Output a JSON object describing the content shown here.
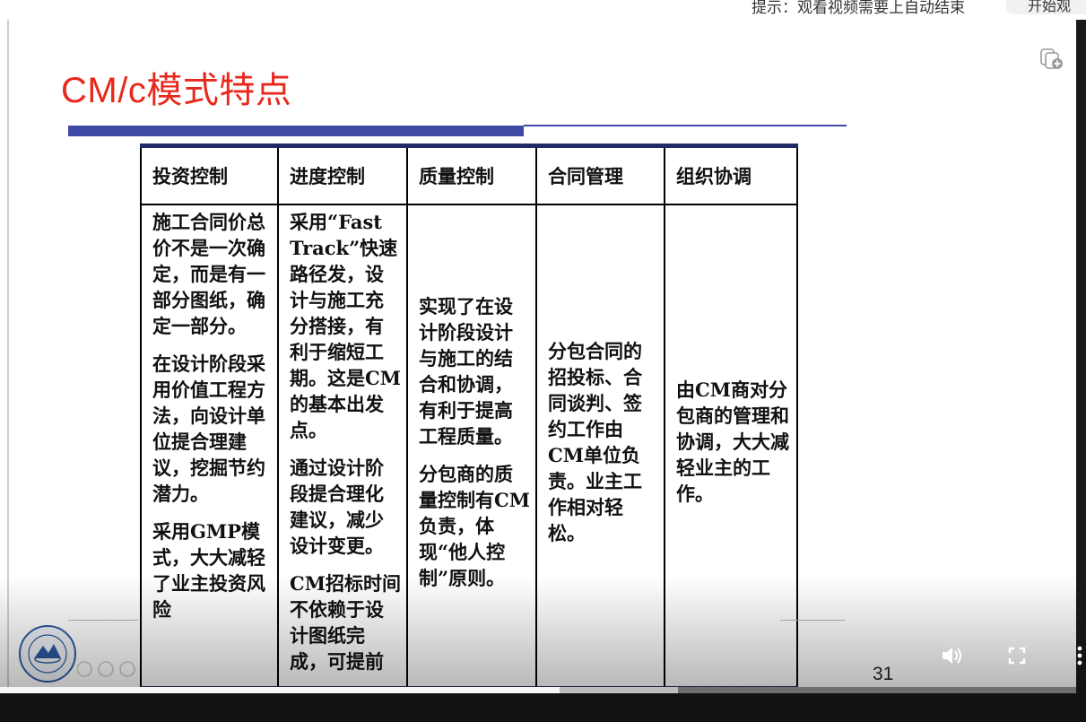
{
  "browser_bar": {
    "hint_text": "提示：观看视频需要上自动结束",
    "pill_text": "开始观"
  },
  "slide": {
    "title": "CM/c模式特点",
    "page_number": "31",
    "table": {
      "headers": [
        "投资控制",
        "进度控制",
        "质量控制",
        "合同管理",
        "组织协调"
      ],
      "columns": [
        [
          "施工合同价总价不是一次确定，而是有一部分图纸，确定一部分。",
          "在设计阶段采用价值工程方法，向设计单位提合理建议，挖掘节约潜力。",
          "采用GMP模式，大大减轻了业主投资风险"
        ],
        [
          "采用“Fast Track”快速路径发，设计与施工充分搭接，有利于缩短工期。这是CM的基本出发点。",
          "通过设计阶段提合理化建议，减少设计变更。",
          "CM招标时间不依赖于设计图纸完成，可提前"
        ],
        [
          "实现了在设计阶段设计与施工的结合和协调，有利于提高工程质量。",
          "分包商的质量控制有CM负责，体现“他人控制”原则。"
        ],
        [
          "分包合同的招投标、合同谈判、签约工作由CM单位负责。业主工作相对轻松。"
        ],
        [
          "由CM商对分包商的管理和协调，大大减轻业主的工作。"
        ]
      ]
    }
  },
  "player": {
    "progress": 0.52,
    "buffered": 0.63,
    "icons": {
      "volume": "volume-icon",
      "fullscreen": "fullscreen-icon",
      "more": "more-vertical-icon",
      "copy": "copy-add-icon"
    }
  },
  "colors": {
    "title": "#e8281c",
    "accent_bar": "#3e4aa6",
    "table_rule": "#1f2a66"
  }
}
